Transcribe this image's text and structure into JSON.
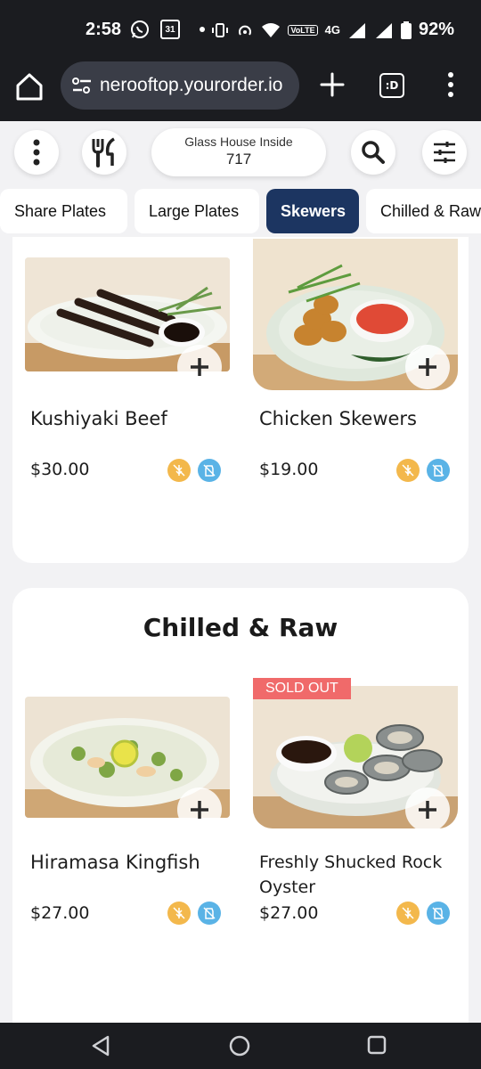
{
  "status": {
    "time": "2:58",
    "calendar_day": "31",
    "network": "4G",
    "battery": "92%"
  },
  "browser": {
    "url": "nerooftop.yourorder.io",
    "tabs_label": ":D"
  },
  "header": {
    "location": "Glass House Inside",
    "table_number": "717"
  },
  "categories": [
    {
      "label": "Share Plates",
      "active": false
    },
    {
      "label": "Large Plates",
      "active": false
    },
    {
      "label": "Skewers",
      "active": true
    },
    {
      "label": "Chilled & Raw",
      "active": false
    }
  ],
  "skewers": {
    "items": [
      {
        "name": "Kushiyaki Beef",
        "price": "$30.00"
      },
      {
        "name": "Chicken Skewers",
        "price": "$19.00"
      }
    ]
  },
  "chilled_raw": {
    "title": "Chilled & Raw",
    "items": [
      {
        "name": "Hiramasa Kingfish",
        "price": "$27.00",
        "badge": ""
      },
      {
        "name": "Freshly Shucked Rock Oyster",
        "price": "$27.00",
        "badge": "SOLD OUT"
      }
    ]
  },
  "colors": {
    "accent": "#1c3561",
    "gluten_free": "#f3b84c",
    "dairy_free": "#5ab3e6",
    "sold_out": "#f06a6a"
  }
}
